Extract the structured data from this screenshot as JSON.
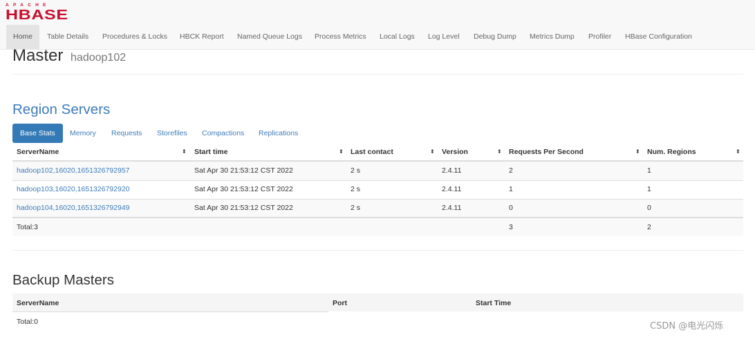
{
  "logo": {
    "top": "APACHE",
    "main": "HBASE"
  },
  "nav": {
    "items": [
      "Home",
      "Table Details",
      "Procedures & Locks",
      "HBCK Report",
      "Named Queue Logs",
      "Process Metrics",
      "Local Logs",
      "Log Level",
      "Debug Dump",
      "Metrics Dump",
      "Profiler",
      "HBase Configuration"
    ],
    "active_index": 0
  },
  "header": {
    "title": "Master",
    "host": "hadoop102"
  },
  "region_servers": {
    "title": "Region Servers",
    "tabs": [
      "Base Stats",
      "Memory",
      "Requests",
      "Storefiles",
      "Compactions",
      "Replications"
    ],
    "active_tab_index": 0,
    "columns": [
      "ServerName",
      "Start time",
      "Last contact",
      "Version",
      "Requests Per Second",
      "Num. Regions"
    ],
    "rows": [
      [
        "hadoop102,16020,1651326792957",
        "Sat Apr 30 21:53:12 CST 2022",
        "2 s",
        "2.4.11",
        "2",
        "1"
      ],
      [
        "hadoop103,16020,1651326792920",
        "Sat Apr 30 21:53:12 CST 2022",
        "2 s",
        "2.4.11",
        "1",
        "1"
      ],
      [
        "hadoop104,16020,1651326792949",
        "Sat Apr 30 21:53:12 CST 2022",
        "2 s",
        "2.4.11",
        "0",
        "0"
      ]
    ],
    "total": {
      "label": "Total:3",
      "requests": "3",
      "regions": "2"
    }
  },
  "backup_masters": {
    "title": "Backup Masters",
    "columns": [
      "ServerName",
      "Port",
      "Start Time"
    ],
    "total": "Total:0"
  },
  "watermark": "CSDN @电光闪烁",
  "colors": {
    "link": "#3f7cbb",
    "active_tab": "#337ab7",
    "logo": "#c8102e",
    "nav_bg": "#f8f8f8",
    "row_stripe": "#f9f9f9"
  }
}
